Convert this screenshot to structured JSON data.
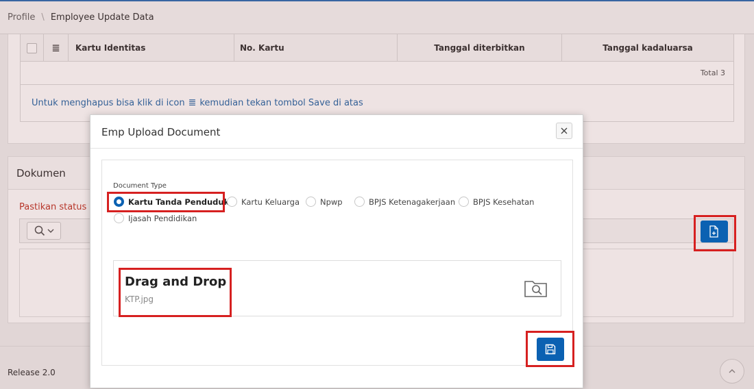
{
  "breadcrumb": {
    "parent": "Profile",
    "separator": "\\",
    "current": "Employee Update Data"
  },
  "identity_grid": {
    "columns": [
      "Kartu Identitas",
      "No. Kartu",
      "Tanggal diterbitkan",
      "Tanggal kadaluarsa"
    ],
    "menu_icon": "hamburger-icon",
    "total": "Total 3",
    "hint_before": "Untuk menghapus bisa klik di icon",
    "hint_icon": "≣",
    "hint_after": "kemudian tekan tombol Save di atas"
  },
  "dokumen": {
    "title": "Dokumen",
    "warning_visible": "Pastikan status d",
    "upload_icon": "file-add-icon"
  },
  "dialog": {
    "title": "Emp Upload Document",
    "document_type": {
      "label": "Document Type",
      "options": [
        "Kartu Tanda Penduduk",
        "Kartu Keluarga",
        "Npwp",
        "BPJS Ketenagakerjaan",
        "BPJS Kesehatan",
        "Ijasah Pendidikan"
      ],
      "selected": "Kartu Tanda Penduduk"
    },
    "dropzone": {
      "title": "Drag and Drop",
      "file_name": "KTP.jpg",
      "icon": "folder-search-icon"
    },
    "save_icon": "save-icon"
  },
  "footer": {
    "release": "Release 2.0"
  },
  "colors": {
    "primary": "#0b61b2",
    "highlight": "#d62020",
    "hint": "#2a6aa8",
    "warning": "#c0392b"
  }
}
